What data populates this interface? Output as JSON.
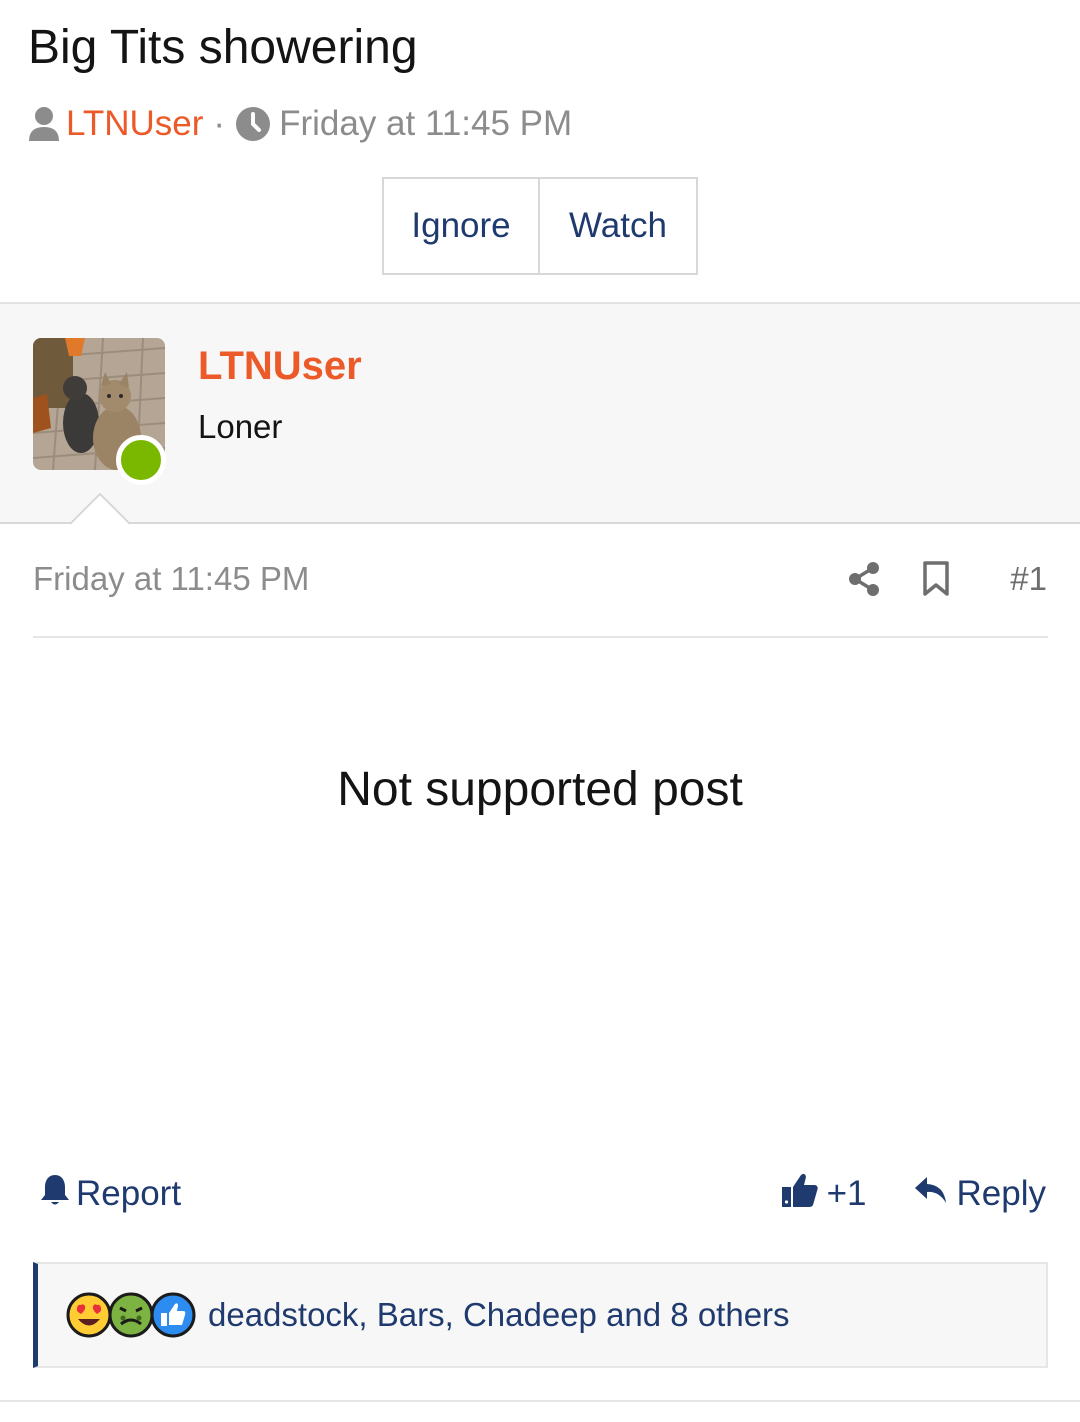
{
  "thread": {
    "title": "Big Tits showering",
    "author": "LTNUser",
    "separator": "·",
    "date": "Friday at 11:45 PM",
    "buttons": {
      "ignore": "Ignore",
      "watch": "Watch"
    }
  },
  "user": {
    "name": "LTNUser",
    "title": "Loner",
    "status": "online",
    "avatar_icon": "avatar-cats-photo"
  },
  "post": {
    "date": "Friday at 11:45 PM",
    "number": "#1",
    "body": "Not supported post"
  },
  "actions": {
    "report": "Report",
    "like": "+1",
    "reply": "Reply"
  },
  "reactions": {
    "icons": [
      "heart-eyes-emoji-icon",
      "sick-emoji-icon",
      "thumbs-up-reaction-icon"
    ],
    "summary": "deadstock, Bars, Chadeep and 8 others"
  },
  "colors": {
    "accent_orange": "#eb5a28",
    "link_blue": "#1f3a6e",
    "online_green": "#7ab800",
    "muted_gray": "#8c8c8c"
  }
}
